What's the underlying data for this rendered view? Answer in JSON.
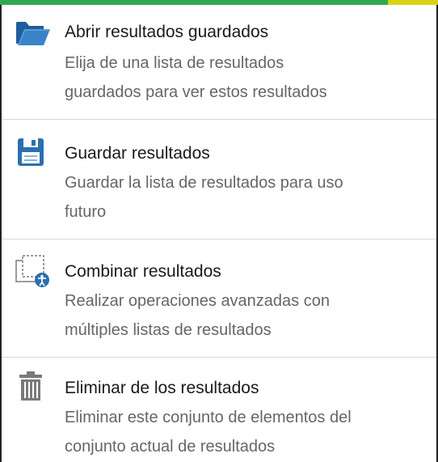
{
  "menu": {
    "items": [
      {
        "icon": "folder-open-icon",
        "title": "Abrir resultados guardados",
        "desc_line1": "Elija de una lista de resultados",
        "desc_line2": "guardados para ver estos resultados"
      },
      {
        "icon": "save-icon",
        "title": "Guardar resultados",
        "desc_line1": "Guardar la lista de resultados para uso",
        "desc_line2": "futuro"
      },
      {
        "icon": "combine-results-icon",
        "title": "Combinar resultados",
        "desc_line1": "Realizar operaciones avanzadas con",
        "desc_line2": "múltiples listas de resultados"
      },
      {
        "icon": "trash-icon",
        "title": "Eliminar de los resultados",
        "desc_line1": "Eliminar este conjunto de elementos del",
        "desc_line2": "conjunto actual de resultados"
      }
    ]
  },
  "colors": {
    "top_strip": "#2fa84f",
    "top_strip_accent": "#d8d312",
    "icon_blue": "#2c6fb0",
    "trash_gray": "#7a7a7a"
  }
}
